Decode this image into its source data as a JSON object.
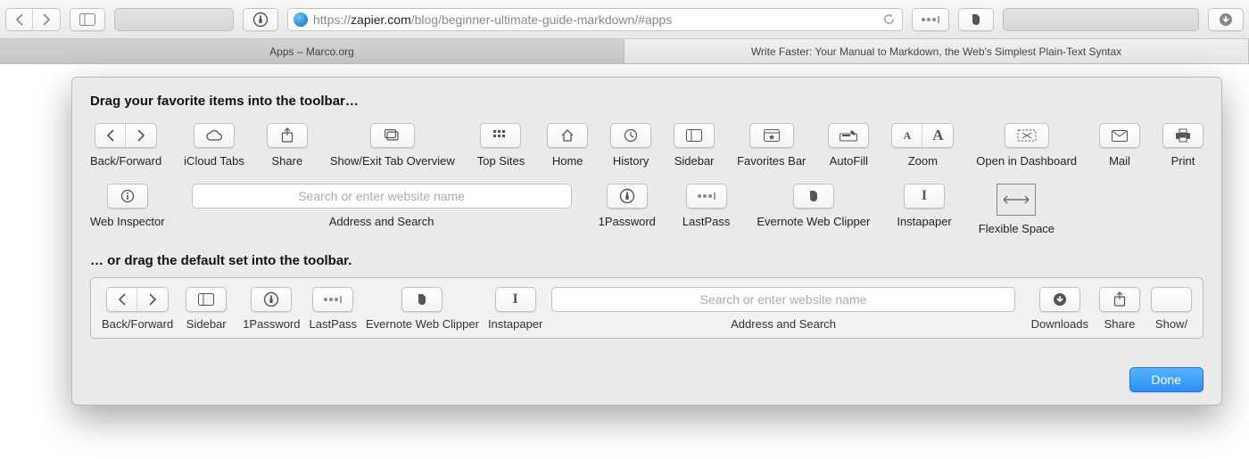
{
  "toolbar": {
    "url_plain": "https://",
    "url_host": "zapier.com",
    "url_path": "/blog/beginner-ultimate-guide-markdown/#apps"
  },
  "tabs": [
    {
      "title": "Apps – Marco.org",
      "active": false
    },
    {
      "title": "Write Faster: Your Manual to Markdown, the Web's Simplest Plain-Text Syntax",
      "active": true
    }
  ],
  "panel": {
    "heading1": "Drag your favorite items into the toolbar…",
    "heading2": "… or drag the default set into the toolbar.",
    "done_label": "Done",
    "addr_placeholder": "Search or enter website name",
    "row1": [
      {
        "id": "back-forward",
        "label": "Back/Forward"
      },
      {
        "id": "icloud-tabs",
        "label": "iCloud Tabs"
      },
      {
        "id": "share",
        "label": "Share"
      },
      {
        "id": "tab-overview",
        "label": "Show/Exit Tab Overview"
      },
      {
        "id": "top-sites",
        "label": "Top Sites"
      },
      {
        "id": "home",
        "label": "Home"
      },
      {
        "id": "history",
        "label": "History"
      },
      {
        "id": "sidebar",
        "label": "Sidebar"
      },
      {
        "id": "favorites-bar",
        "label": "Favorites Bar"
      },
      {
        "id": "autofill",
        "label": "AutoFill"
      },
      {
        "id": "zoom",
        "label": "Zoom"
      },
      {
        "id": "open-dashboard",
        "label": "Open in Dashboard"
      },
      {
        "id": "mail",
        "label": "Mail"
      },
      {
        "id": "print",
        "label": "Print"
      }
    ],
    "row2": [
      {
        "id": "web-inspector",
        "label": "Web Inspector"
      },
      {
        "id": "address-search",
        "label": "Address and Search"
      },
      {
        "id": "1password",
        "label": "1Password"
      },
      {
        "id": "lastpass",
        "label": "LastPass"
      },
      {
        "id": "evernote",
        "label": "Evernote Web Clipper"
      },
      {
        "id": "instapaper",
        "label": "Instapaper"
      },
      {
        "id": "flexible-space",
        "label": "Flexible Space"
      }
    ],
    "default_set": [
      {
        "id": "back-forward",
        "label": "Back/Forward"
      },
      {
        "id": "sidebar",
        "label": "Sidebar"
      },
      {
        "id": "1password",
        "label": "1Password"
      },
      {
        "id": "lastpass",
        "label": "LastPass"
      },
      {
        "id": "evernote",
        "label": "Evernote Web Clipper"
      },
      {
        "id": "instapaper",
        "label": "Instapaper"
      },
      {
        "id": "address-search",
        "label": "Address and Search"
      },
      {
        "id": "downloads",
        "label": "Downloads"
      },
      {
        "id": "share",
        "label": "Share"
      },
      {
        "id": "tab-overview-trunc",
        "label": "Show/"
      }
    ]
  }
}
